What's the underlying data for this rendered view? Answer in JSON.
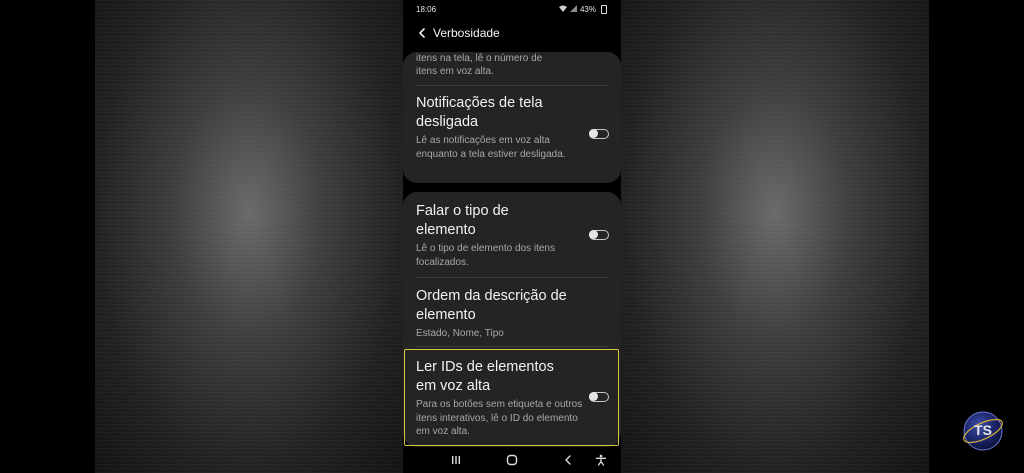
{
  "status_bar": {
    "time": "18:06",
    "battery": "43%"
  },
  "app_bar": {
    "title": "Verbosidade",
    "back_icon": "chevron-left-icon"
  },
  "partial_item": {
    "subtitle_line1": "itens na tela, lê o número de",
    "subtitle_line2": "itens em voz alta."
  },
  "settings": [
    {
      "title": "Notificações de tela desligada",
      "subtitle": "Lê as notificações em voz alta enquanto a tela estiver desligada.",
      "toggle": "off"
    },
    {
      "title": "Falar o tipo de elemento",
      "subtitle": "Lê o tipo de elemento dos itens focalizados.",
      "toggle": "off"
    },
    {
      "title": "Ordem da descrição de elemento",
      "subtitle": "Estado, Nome, Tipo"
    },
    {
      "title": "Ler IDs de elementos em voz alta",
      "subtitle": "Para os botões sem etiqueta e outros itens interativos, lê o ID do elemento em voz alta.",
      "toggle": "off",
      "focused": true
    }
  ],
  "navigation_bar": {
    "icons": [
      "recents-icon",
      "home-icon",
      "back-icon",
      "accessibility-icon"
    ]
  },
  "watermark": {
    "text": "TS"
  },
  "colors": {
    "focus_highlight": "#d6c640",
    "card_background": "#242424"
  }
}
